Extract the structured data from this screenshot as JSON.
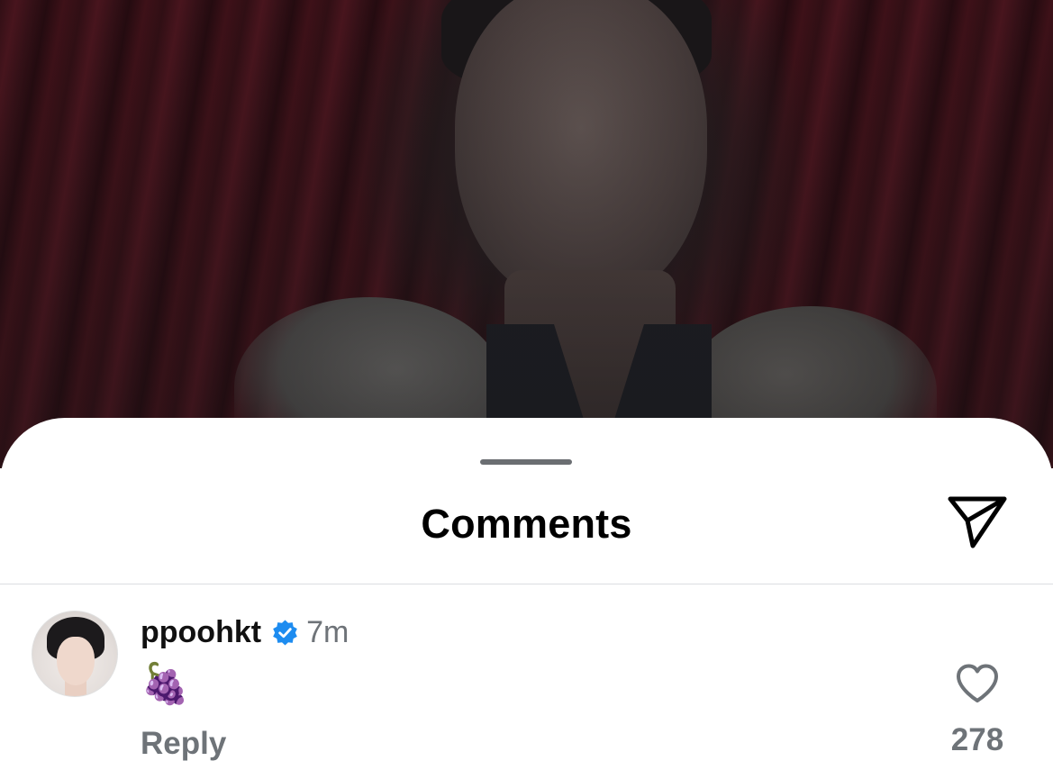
{
  "sheet": {
    "title": "Comments",
    "share_icon": "send-icon"
  },
  "comment": {
    "username": "ppoohkt",
    "verified_icon": "verified-badge-icon",
    "timestamp": "7m",
    "text": "🍇",
    "reply_label": "Reply",
    "like_icon": "heart-icon",
    "like_count": "278"
  },
  "colors": {
    "verified_blue": "#1d8cf0",
    "secondary_text": "#6e7378",
    "primary_text": "#111111"
  }
}
